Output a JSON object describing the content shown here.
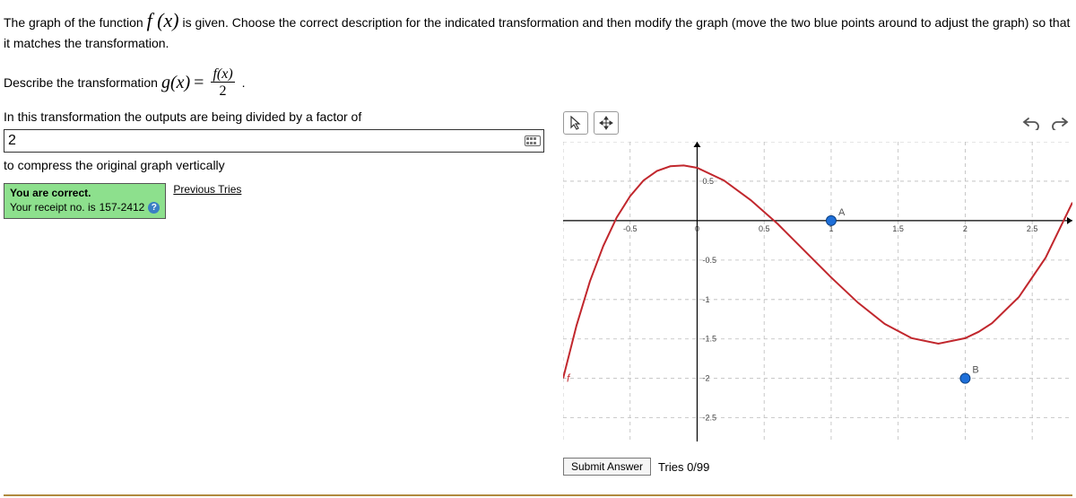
{
  "instructions": {
    "pre_fx": "The graph of the function ",
    "fx": "f (x)",
    "post_fx": " is given. Choose the correct description for the indicated transformation and then modify the graph (move the two blue points around to adjust the graph) so that it matches the transformation."
  },
  "describe": {
    "pre": "Describe the transformation ",
    "gx": "g(x)",
    "equals": " = ",
    "num": "f(x)",
    "den": "2",
    "period": "."
  },
  "line2": "In this transformation the outputs are being divided by a factor of",
  "answer_value": "2",
  "below_input": "to compress the original graph vertically",
  "feedback": {
    "line1": "You are correct.",
    "line2_pre": "Your receipt no. is ",
    "receipt": "157-2412",
    "help": "?"
  },
  "prev_tries": "Previous Tries",
  "submit": {
    "button": "Submit Answer",
    "tries": "Tries 0/99"
  },
  "graph": {
    "labels": {
      "A": "A",
      "B": "B",
      "f": "f"
    },
    "xticks": [
      "-0.5",
      "0",
      "0.5",
      "1",
      "1.5",
      "2",
      "2.5"
    ],
    "yticks": [
      "0.5",
      "-0.5",
      "-1",
      "-1.5",
      "-2",
      "-2.5"
    ]
  },
  "chart_data": {
    "type": "line",
    "title": "",
    "xlabel": "",
    "ylabel": "",
    "xlim": [
      -1,
      2.8
    ],
    "ylim": [
      -2.8,
      1
    ],
    "grid": true,
    "y_axis_at_x": 0,
    "x_axis_at_y": 0,
    "series": [
      {
        "name": "f",
        "color": "#c1272d",
        "x": [
          -1.0,
          -0.9,
          -0.8,
          -0.7,
          -0.6,
          -0.5,
          -0.4,
          -0.3,
          -0.2,
          -0.1,
          0.0,
          0.2,
          0.4,
          0.6,
          0.8,
          1.0,
          1.2,
          1.4,
          1.6,
          1.8,
          2.0,
          2.1,
          2.2,
          2.4,
          2.6,
          2.8
        ],
        "y": [
          -2.0,
          -1.33,
          -0.77,
          -0.32,
          0.04,
          0.31,
          0.51,
          0.63,
          0.69,
          0.7,
          0.67,
          0.51,
          0.26,
          -0.04,
          -0.38,
          -0.72,
          -1.04,
          -1.31,
          -1.49,
          -1.56,
          -1.49,
          -1.41,
          -1.3,
          -0.97,
          -0.47,
          0.23
        ]
      }
    ],
    "points": [
      {
        "name": "A",
        "x": 1.0,
        "y": 0.0,
        "color": "#1e6fd9"
      },
      {
        "name": "B",
        "x": 2.0,
        "y": -2.0,
        "color": "#1e6fd9"
      }
    ]
  }
}
